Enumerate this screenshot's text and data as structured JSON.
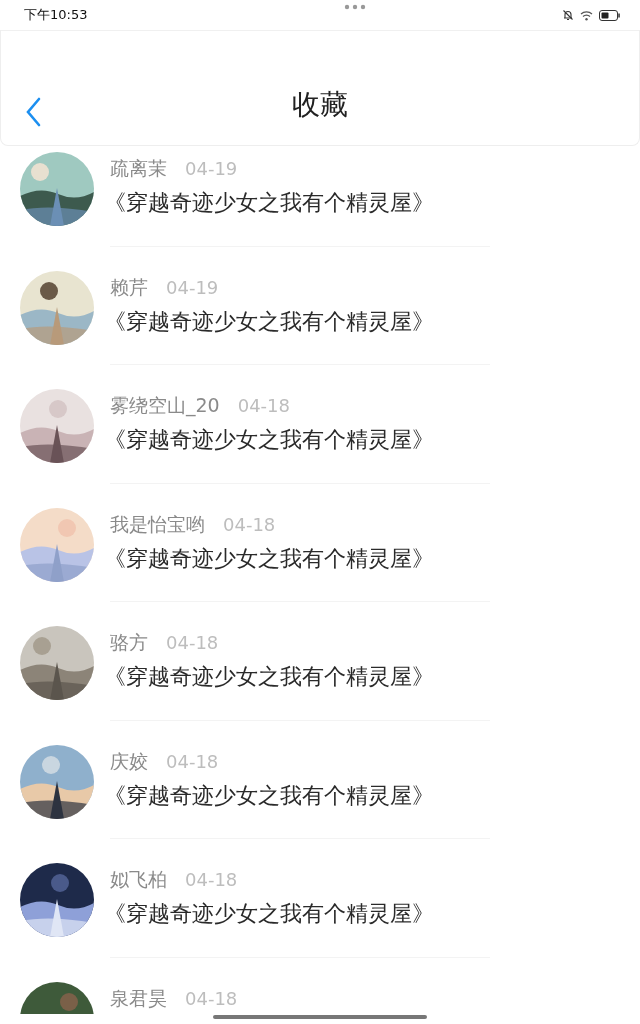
{
  "status_bar": {
    "time": "下午10:53"
  },
  "header": {
    "title": "收藏"
  },
  "items": [
    {
      "name": "疏离茉",
      "date": "04-19",
      "title": "《穿越奇迹少女之我有个精灵屋》"
    },
    {
      "name": "赖芹",
      "date": "04-19",
      "title": "《穿越奇迹少女之我有个精灵屋》"
    },
    {
      "name": "雾绕空山_20",
      "date": "04-18",
      "title": "《穿越奇迹少女之我有个精灵屋》"
    },
    {
      "name": "我是怡宝哟",
      "date": "04-18",
      "title": "《穿越奇迹少女之我有个精灵屋》"
    },
    {
      "name": "骆方",
      "date": "04-18",
      "title": "《穿越奇迹少女之我有个精灵屋》"
    },
    {
      "name": "庆姣",
      "date": "04-18",
      "title": "《穿越奇迹少女之我有个精灵屋》"
    },
    {
      "name": "姒飞柏",
      "date": "04-18",
      "title": "《穿越奇迹少女之我有个精灵屋》"
    },
    {
      "name": "泉君昊",
      "date": "04-18"
    }
  ]
}
